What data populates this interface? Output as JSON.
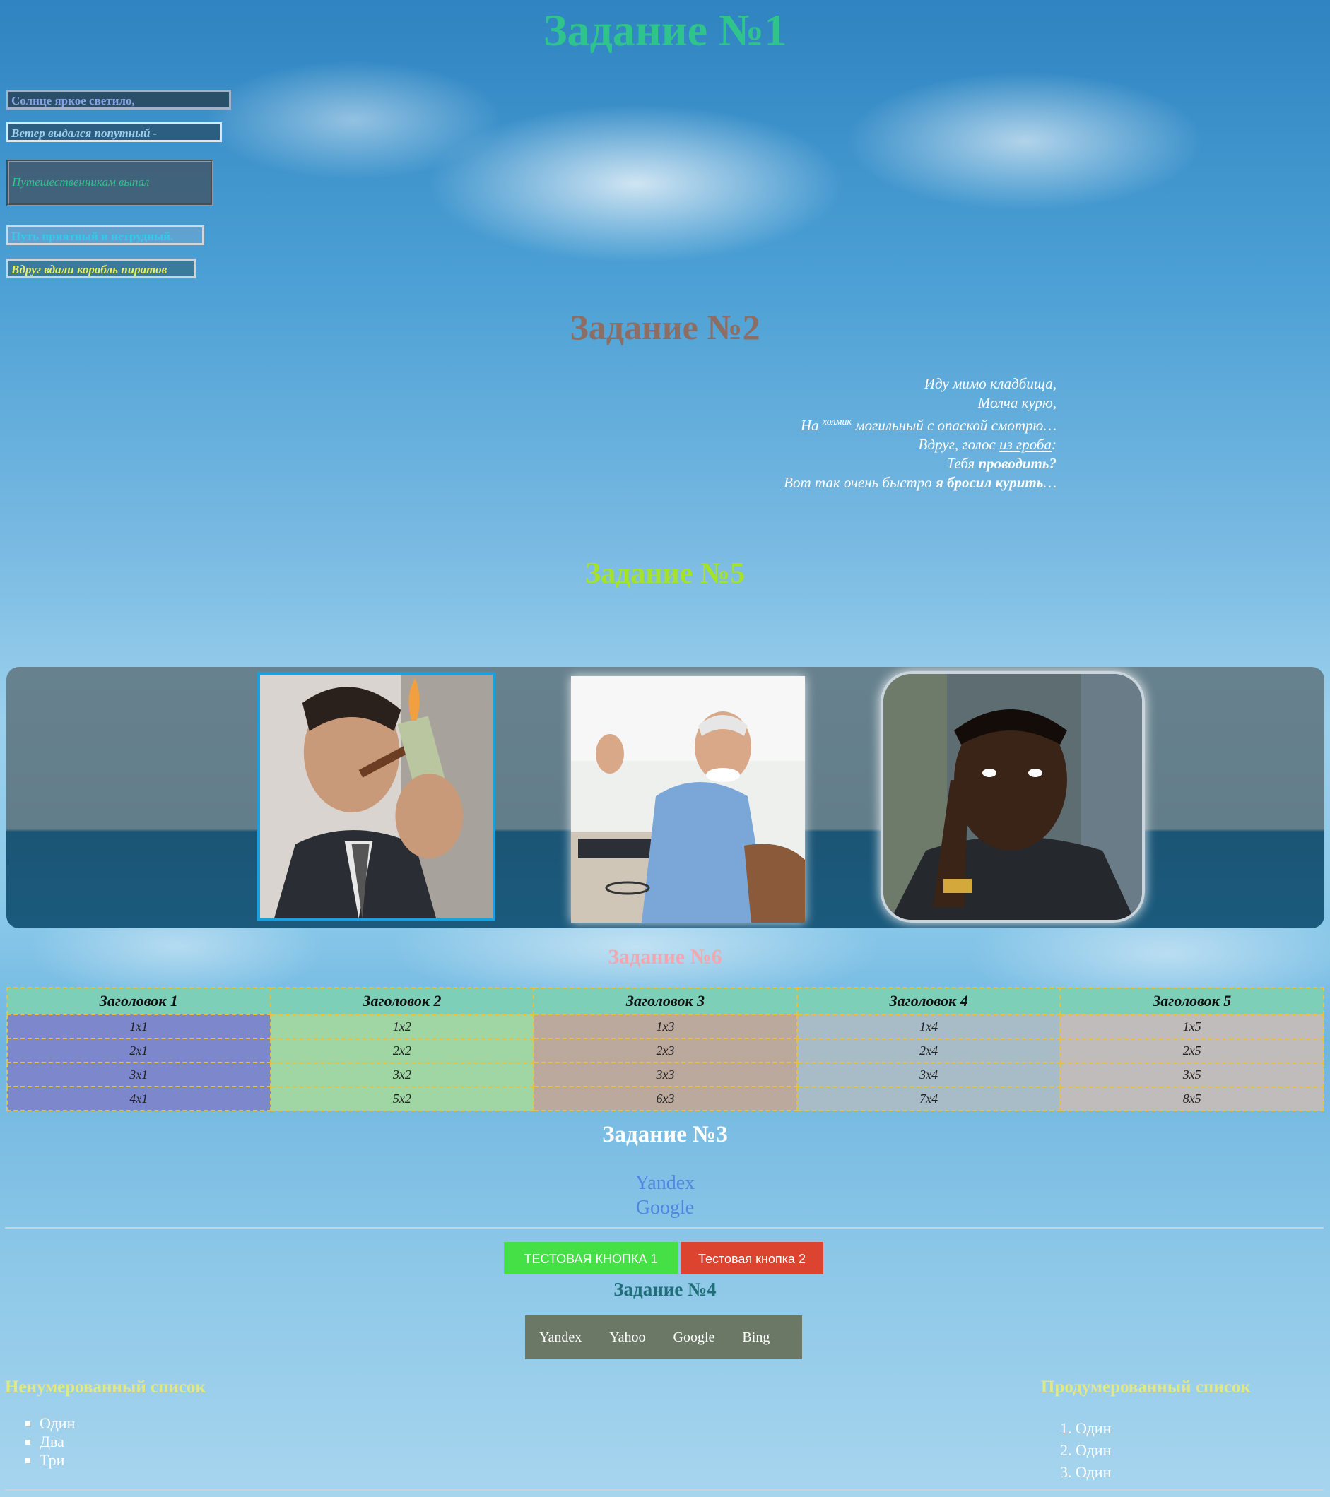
{
  "task1": {
    "title": "Задание №1",
    "poem": [
      "Солнце яркое светило,",
      "Ветер выдался попутный -",
      "Путешественникам выпал",
      "Путь приятный и нетрудный.",
      "Вдруг вдали корабль пиратов"
    ]
  },
  "task2": {
    "title": "Задание №2",
    "line1": "Иду мимо кладбища,",
    "line2": "Молча курю,",
    "line3_a": "На ",
    "line3_sup": "холмик",
    "line3_b": " могильный с опаской смотрю…",
    "line4_a": "Вдруг, голос ",
    "line4_link": "из гроба",
    "line4_b": ":",
    "line5_a": "Тебя ",
    "line5_b": "проводить?",
    "line6_a": "Вот так очень быстро ",
    "line6_b": "я бросил курить",
    "line6_c": "…"
  },
  "task5": {
    "title": "Задание №5",
    "photos": [
      "man-burning-money-photo",
      "smiling-old-man-photo",
      "thinking-man-photo"
    ]
  },
  "task6": {
    "title": "Задание №6",
    "headers": [
      "Заголовок 1",
      "Заголовок 2",
      "Заголовок 3",
      "Заголовок 4",
      "Заголовок 5"
    ],
    "rows": [
      [
        "1x1",
        "1x2",
        "1x3",
        "1x4",
        "1x5"
      ],
      [
        "2x1",
        "2x2",
        "2x3",
        "2x4",
        "2x5"
      ],
      [
        "3x1",
        "3x2",
        "3x3",
        "3x4",
        "3x5"
      ],
      [
        "4x1",
        "5x2",
        "6x3",
        "7x4",
        "8x5"
      ]
    ]
  },
  "task3": {
    "title": "Задание №3",
    "links": [
      "Yandex",
      "Google"
    ]
  },
  "buttons": {
    "button1": "ТЕСТОВАЯ КНОПКА 1",
    "button2": "Тестовая кнопка 2"
  },
  "task4": {
    "title": "Задание №4",
    "nav": [
      "Yandex",
      "Yahoo",
      "Google",
      "Bing"
    ]
  },
  "lists": {
    "unordered_title": "Ненумерованный список",
    "unordered": [
      "Один",
      "Два",
      "Три"
    ],
    "ordered_title": "Продумерованный список",
    "ordered": [
      "Один",
      "Один",
      "Один"
    ]
  },
  "colors": {
    "task1_title": "#2ec48c",
    "task2_title": "#8c6e64",
    "task5_title": "#a6e22a",
    "task6_title": "#f2a7b0",
    "button1": "#45e045",
    "button2": "#dd4430",
    "nav_bg": "#6b7866",
    "table_border": "#e8c040"
  }
}
